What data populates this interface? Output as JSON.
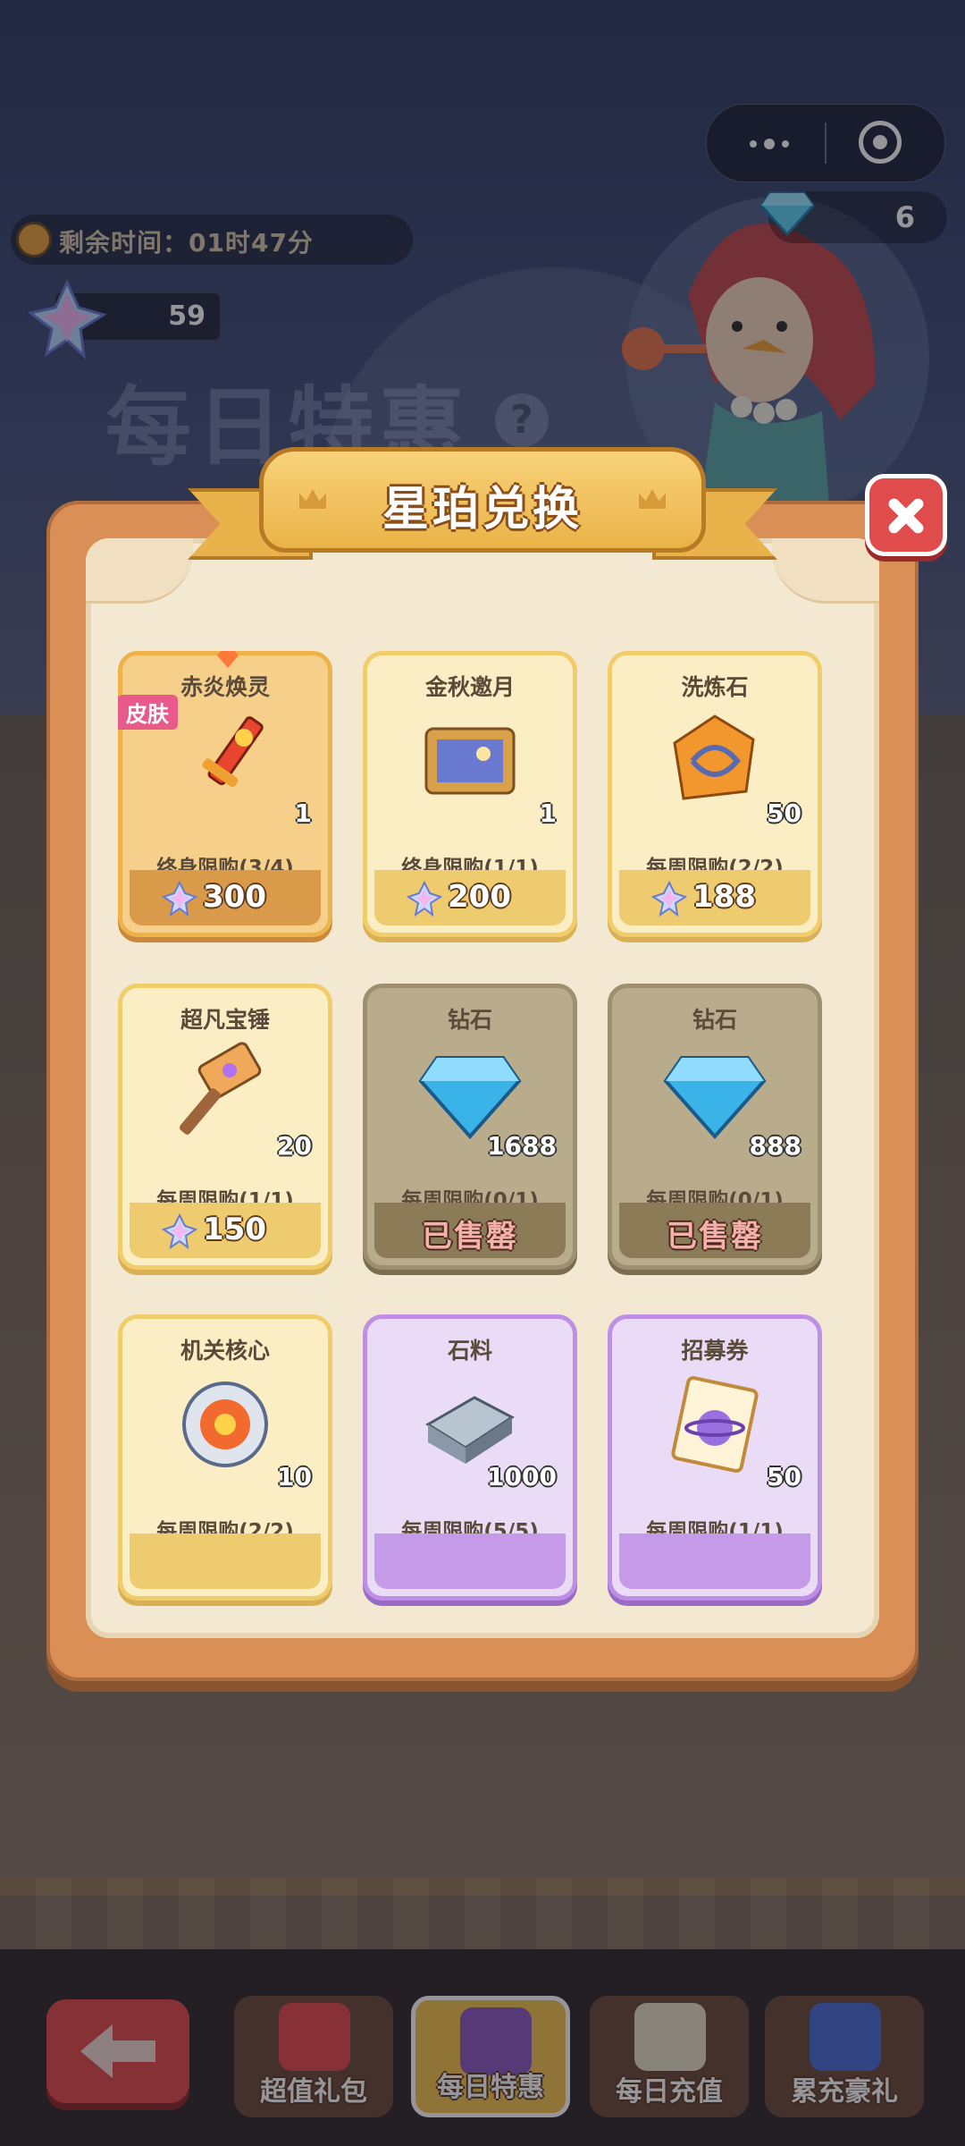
{
  "hud": {
    "diamond_count": "6",
    "timer_text": "剩余时间：01时47分",
    "star_count": "59"
  },
  "background": {
    "title": "每日特惠",
    "help": "?"
  },
  "modal": {
    "title": "星珀兑换",
    "items": [
      {
        "name": "赤炎焕灵",
        "badge": "皮肤",
        "qty": "1",
        "limit": "终身限购(3/4)",
        "price": "300",
        "style": "orange",
        "icon": "sword-icon"
      },
      {
        "name": "金秋邀月",
        "qty": "1",
        "limit": "终身限购(1/1)",
        "price": "200",
        "style": "gold",
        "icon": "picture-frame-icon"
      },
      {
        "name": "洗炼石",
        "qty": "50",
        "limit": "每周限购(2/2)",
        "price": "188",
        "style": "gold",
        "icon": "refine-stone-icon"
      },
      {
        "name": "超凡宝锤",
        "qty": "20",
        "limit": "每周限购(1/1)",
        "price": "150",
        "style": "gold",
        "icon": "hammer-icon"
      },
      {
        "name": "钻石",
        "qty": "1688",
        "limit": "每周限购(0/1)",
        "soldout": "已售罄",
        "style": "soldout",
        "icon": "diamond-icon"
      },
      {
        "name": "钻石",
        "qty": "888",
        "limit": "每周限购(0/1)",
        "soldout": "已售罄",
        "style": "soldout",
        "icon": "diamond-icon"
      },
      {
        "name": "机关核心",
        "qty": "10",
        "limit": "每周限购(2/2)",
        "style": "gold",
        "icon": "mechanism-core-icon"
      },
      {
        "name": "石料",
        "qty": "1000",
        "limit": "每周限购(5/5)",
        "style": "purple",
        "icon": "stone-block-icon"
      },
      {
        "name": "招募券",
        "qty": "50",
        "limit": "每周限购(1/1)",
        "style": "purple",
        "icon": "recruit-ticket-icon"
      }
    ]
  },
  "bottom_nav": {
    "items": [
      {
        "label": "超值礼包"
      },
      {
        "label": "每日特惠"
      },
      {
        "label": "每日充值"
      },
      {
        "label": "累充豪礼"
      }
    ]
  },
  "colors": {
    "modal_frame": "#d98f55",
    "close_button": "#e04b4b",
    "banner": "#eab347"
  }
}
